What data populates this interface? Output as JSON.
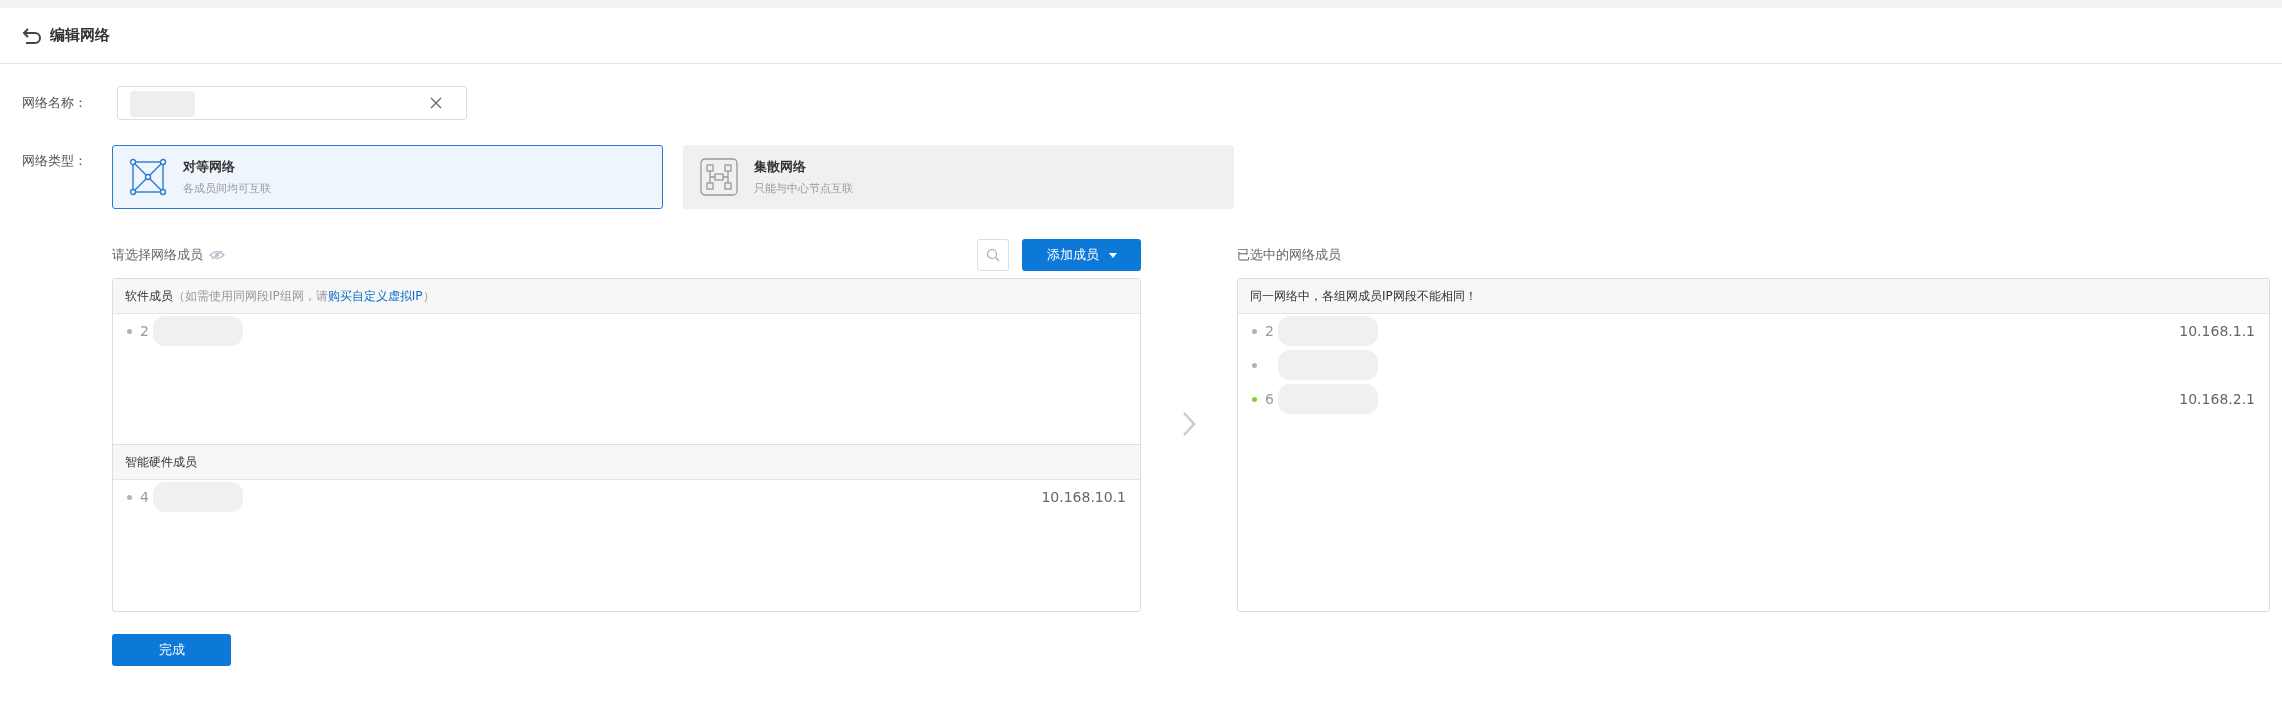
{
  "page_title": "编辑网络",
  "name_field": {
    "label": "网络名称："
  },
  "type_field": {
    "label": "网络类型：",
    "options": [
      {
        "kind": "mesh",
        "title": "对等网络",
        "subtitle": "各成员间均可互联",
        "selected": true
      },
      {
        "kind": "hub",
        "title": "集散网络",
        "subtitle": "只能与中心节点互联",
        "selected": false
      }
    ]
  },
  "left_panel": {
    "title": "请选择网络成员",
    "add_button": "添加成员",
    "sections": [
      {
        "title": "软件成员",
        "note_before": "（如需使用同网段IP组网，请 ",
        "link": "购买自定义虚拟IP",
        "note_after": " ）",
        "members": [
          {
            "name": "2",
            "color": "#b3b3b3"
          }
        ]
      },
      {
        "title": "智能硬件成员",
        "members": [
          {
            "name": "4",
            "ip": "10.168.10.1",
            "color": "#b3b3b3"
          }
        ]
      }
    ]
  },
  "right_panel": {
    "title": "已选中的网络成员",
    "notice": "同一网络中，各组网成员IP网段不能相同！",
    "members": [
      {
        "name": "2",
        "ip": "10.168.1.1",
        "color": "#b3b3b3"
      },
      {
        "color": "#b3b3b3"
      },
      {
        "name": "6",
        "ip": "10.168.2.1",
        "color": "#7ed321"
      }
    ]
  },
  "done_button": "完成"
}
